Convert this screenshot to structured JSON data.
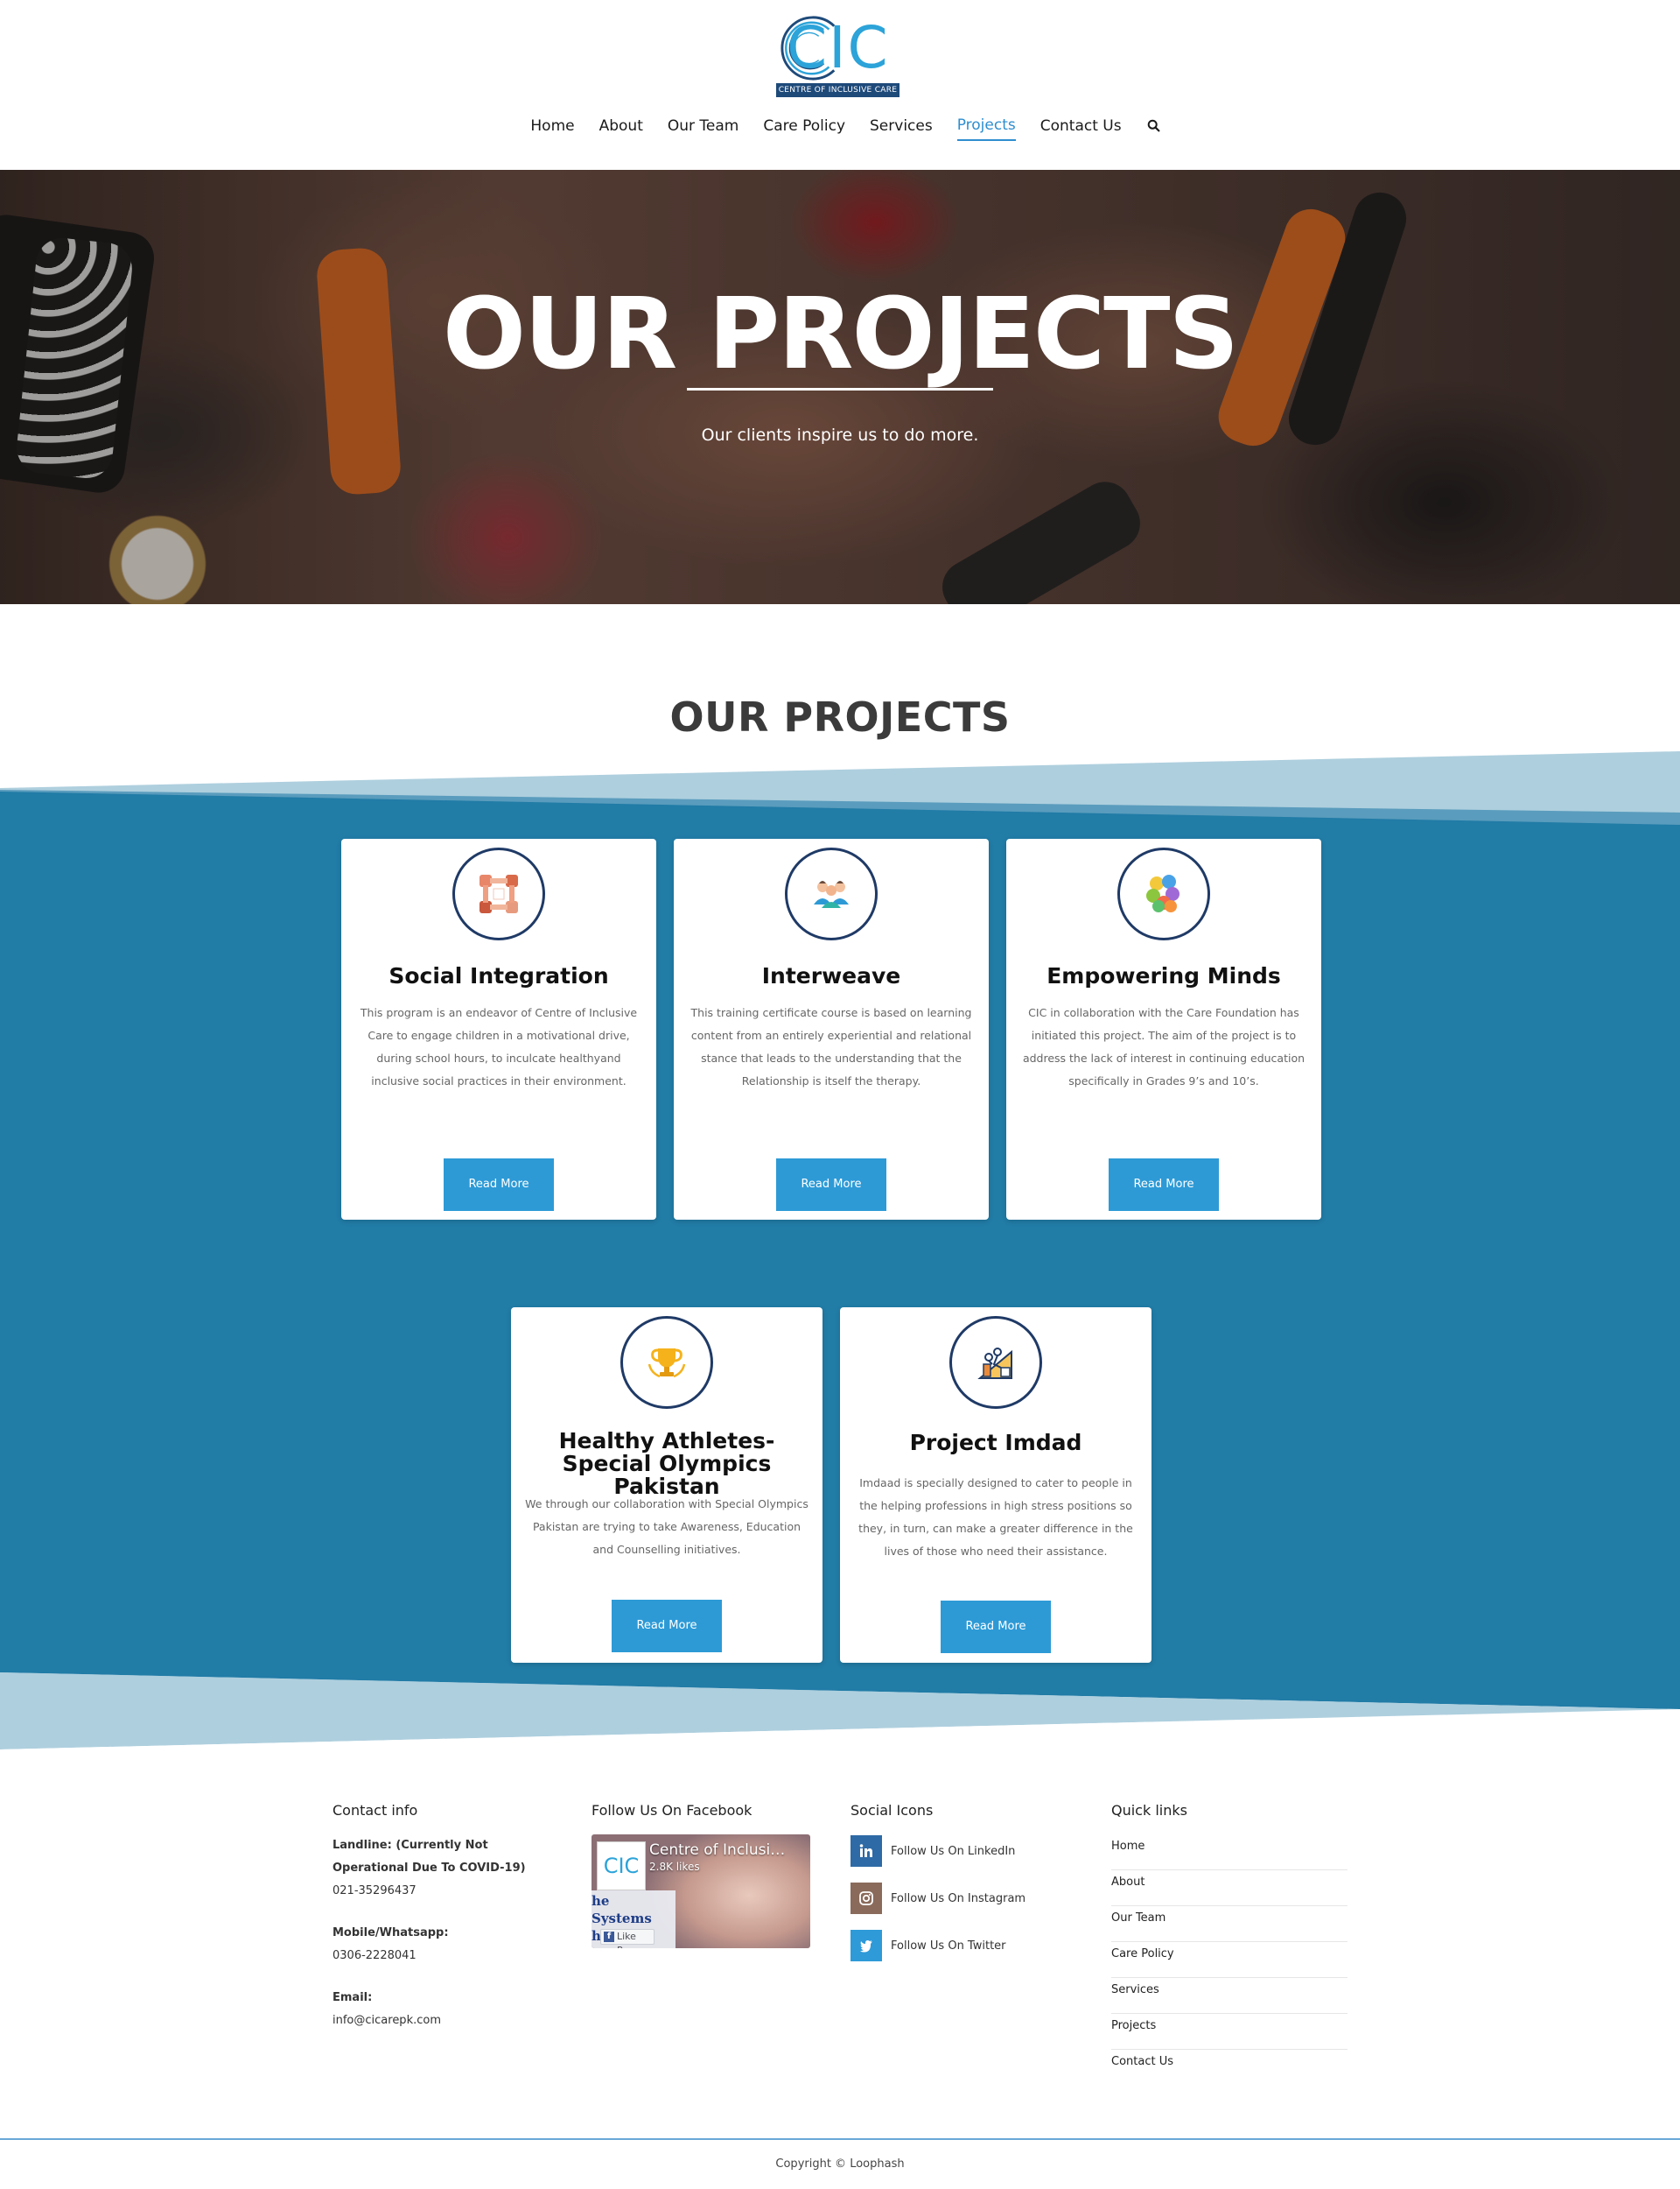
{
  "header": {
    "logo_text": "CIC",
    "logo_tagline": "CENTRE OF INCLUSIVE CARE",
    "nav": [
      {
        "label": "Home"
      },
      {
        "label": "About"
      },
      {
        "label": "Our Team"
      },
      {
        "label": "Care Policy"
      },
      {
        "label": "Services"
      },
      {
        "label": "Projects",
        "active": true
      },
      {
        "label": "Contact Us"
      }
    ],
    "search_icon": "search-icon"
  },
  "hero": {
    "title": "OUR PROJECTS",
    "subtitle": "Our clients inspire us to do more."
  },
  "section": {
    "title": "OUR PROJECTS"
  },
  "projects": [
    {
      "icon": "social-integration-icon",
      "title": "Social Integration",
      "text": "This program is an endeavor of Centre of Inclusive Care to engage children in a motivational drive, during school hours, to inculcate healthyand inclusive social practices in their environment.",
      "button": "Read More"
    },
    {
      "icon": "interweave-icon",
      "title": "Interweave",
      "text": "This training certificate course is based on learning content from an entirely experiential and relational stance that leads to the understanding that the Relationship is itself the therapy.",
      "button": "Read More"
    },
    {
      "icon": "empowering-minds-icon",
      "title": "Empowering Minds",
      "text": "CIC in collaboration with the Care Foundation has initiated this project. The aim of the project is to address the lack of interest in continuing education specifically in Grades 9’s and 10’s.",
      "button": "Read More"
    },
    {
      "icon": "trophy-icon",
      "title": "Healthy Athletes- Special Olympics Pakistan",
      "text": "We through our collaboration with Special Olympics Pakistan are trying to take Awareness, Education and Counselling initiatives.",
      "button": "Read More"
    },
    {
      "icon": "project-imdad-icon",
      "title": "Project Imdad",
      "text": "Imdaad is specially designed to cater to people in the helping professions in high stress positions so they, in turn, can make a greater difference in the lives of those who need their assistance.",
      "button": "Read More"
    }
  ],
  "footer": {
    "contact": {
      "heading": "Contact info",
      "landline_label": "Landline: (Currently Not Operational Due To COVID-19)",
      "landline": "021-35296437",
      "mobile_label": "Mobile/Whatsapp:",
      "mobile": "0306-2228041",
      "email_label": "Email:",
      "email": "info@cicarepk.com"
    },
    "facebook": {
      "heading": "Follow Us On Facebook",
      "page_name": "Centre of Inclusi…",
      "likes": "2.8K likes",
      "logo_text": "CIC",
      "cover_text": "he Systems he Child",
      "like_button": "Like Page"
    },
    "social": {
      "heading": "Social Icons",
      "items": [
        {
          "label": "Follow Us On LinkedIn",
          "icon": "linkedin-icon",
          "color": "#2d6aa6"
        },
        {
          "label": "Follow Us On Instagram",
          "icon": "instagram-icon",
          "color": "#8a6a5a"
        },
        {
          "label": "Follow Us On Twitter",
          "icon": "twitter-icon",
          "color": "#2e9ad8"
        }
      ]
    },
    "quick_links": {
      "heading": "Quick links",
      "items": [
        "Home",
        "About",
        "Our Team",
        "Care Policy",
        "Services",
        "Projects",
        "Contact Us"
      ]
    },
    "copyright": "Copyright © Loophash"
  },
  "colors": {
    "primary_blue": "#2e8ecf",
    "section_blue": "#217ca6",
    "button_blue": "#2d9ad6",
    "icon_ring": "#1f3a66"
  }
}
